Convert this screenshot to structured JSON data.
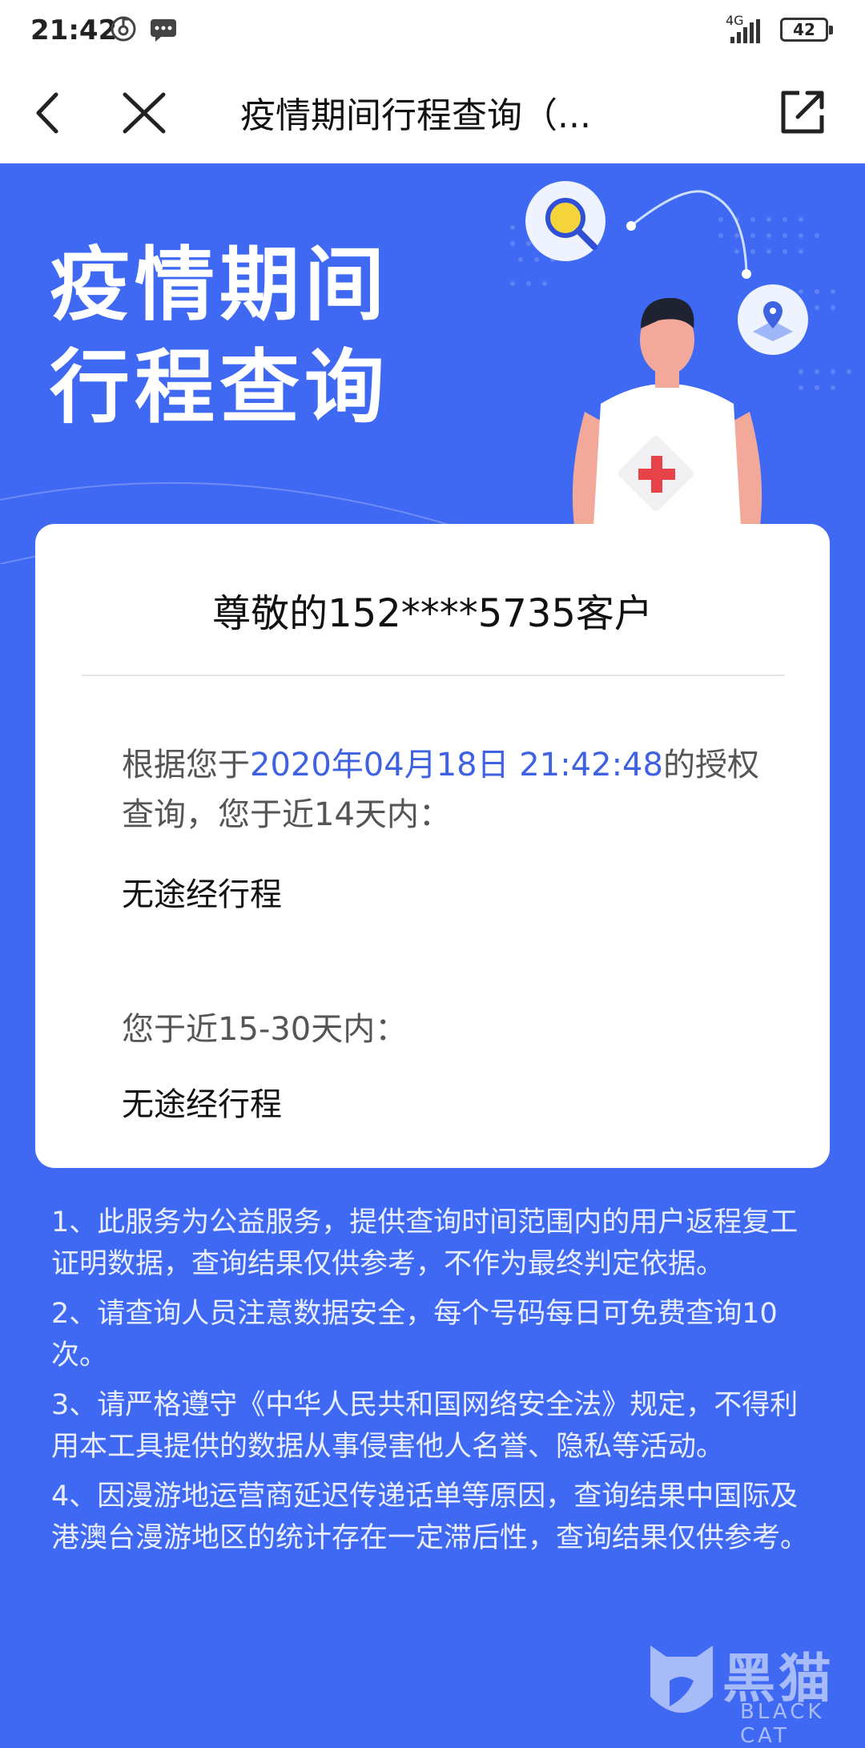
{
  "status_bar": {
    "time": "21:42",
    "network_label": "4G",
    "battery": "42"
  },
  "title_bar": {
    "title": "疫情期间行程查询（..."
  },
  "hero": {
    "title_line1": "疫情期间",
    "title_line2": "行程查询"
  },
  "card": {
    "greeting": "尊敬的152****5735客户",
    "query_prefix": "根据您于",
    "query_datetime": "2020年04月18日 21:42:48",
    "query_suffix": "的授权查询，您于近14天内：",
    "result_14": "无途经行程",
    "query_30": "您于近15-30天内：",
    "result_30": "无途经行程"
  },
  "notes": [
    "1、此服务为公益服务，提供查询时间范围内的用户返程复工证明数据，查询结果仅供参考，不作为最终判定依据。",
    "2、请查询人员注意数据安全，每个号码每日可免费查询10次。",
    "3、请严格遵守《中华人民共和国网络安全法》规定，不得利用本工具提供的数据从事侵害他人名誉、隐私等活动。",
    "4、因漫游地运营商延迟传递话单等原因，查询结果中国际及港澳台漫游地区的统计存在一定滞后性，查询结果仅供参考。"
  ],
  "watermark": {
    "cn": "黑猫",
    "en": "BLACK CAT"
  },
  "colors": {
    "brand_blue": "#3f69f2",
    "highlight": "#3f63e0",
    "cross_red": "#e8424a"
  }
}
